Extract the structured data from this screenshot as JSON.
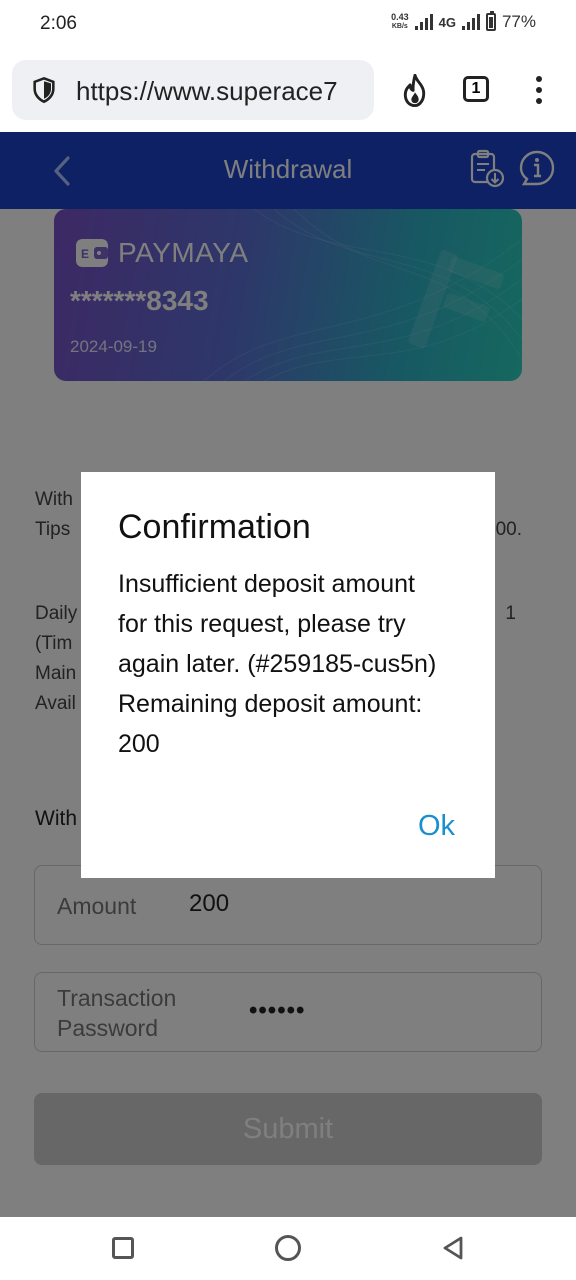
{
  "status_bar": {
    "time": "2:06",
    "speed_value": "0.43",
    "speed_unit": "KB/s",
    "network": "4G",
    "battery": "77%"
  },
  "browser": {
    "url": "https://www.superace7",
    "tab_count": "1"
  },
  "header": {
    "title": "Withdrawal"
  },
  "card": {
    "brand": "PAYMAYA",
    "number": "*******8343",
    "date": "2024-09-19"
  },
  "info_visible": {
    "line1": "With",
    "line2": "Tips",
    "line2_right": "00.",
    "line3": "Daily",
    "line3_right": "1",
    "line4": "(Tim",
    "line5": "Main",
    "line6": "Avail",
    "withdraw_label": "With"
  },
  "form": {
    "amount_label": "Amount",
    "amount_value": "200",
    "password_label_line1": "Transaction",
    "password_label_line2": "Password",
    "password_value": "••••••",
    "submit_label": "Submit"
  },
  "dialog": {
    "title": "Confirmation",
    "message_lines": [
      "Insufficient deposit amount",
      "for this request, please try",
      "again later. (#259185-cus5n)",
      "Remaining deposit amount:",
      "200"
    ],
    "ok_label": "Ok"
  },
  "colors": {
    "header_bg": "#1b42c8",
    "ok_color": "#1a8fd0",
    "overlay": "rgba(0,0,0,0.5)"
  }
}
